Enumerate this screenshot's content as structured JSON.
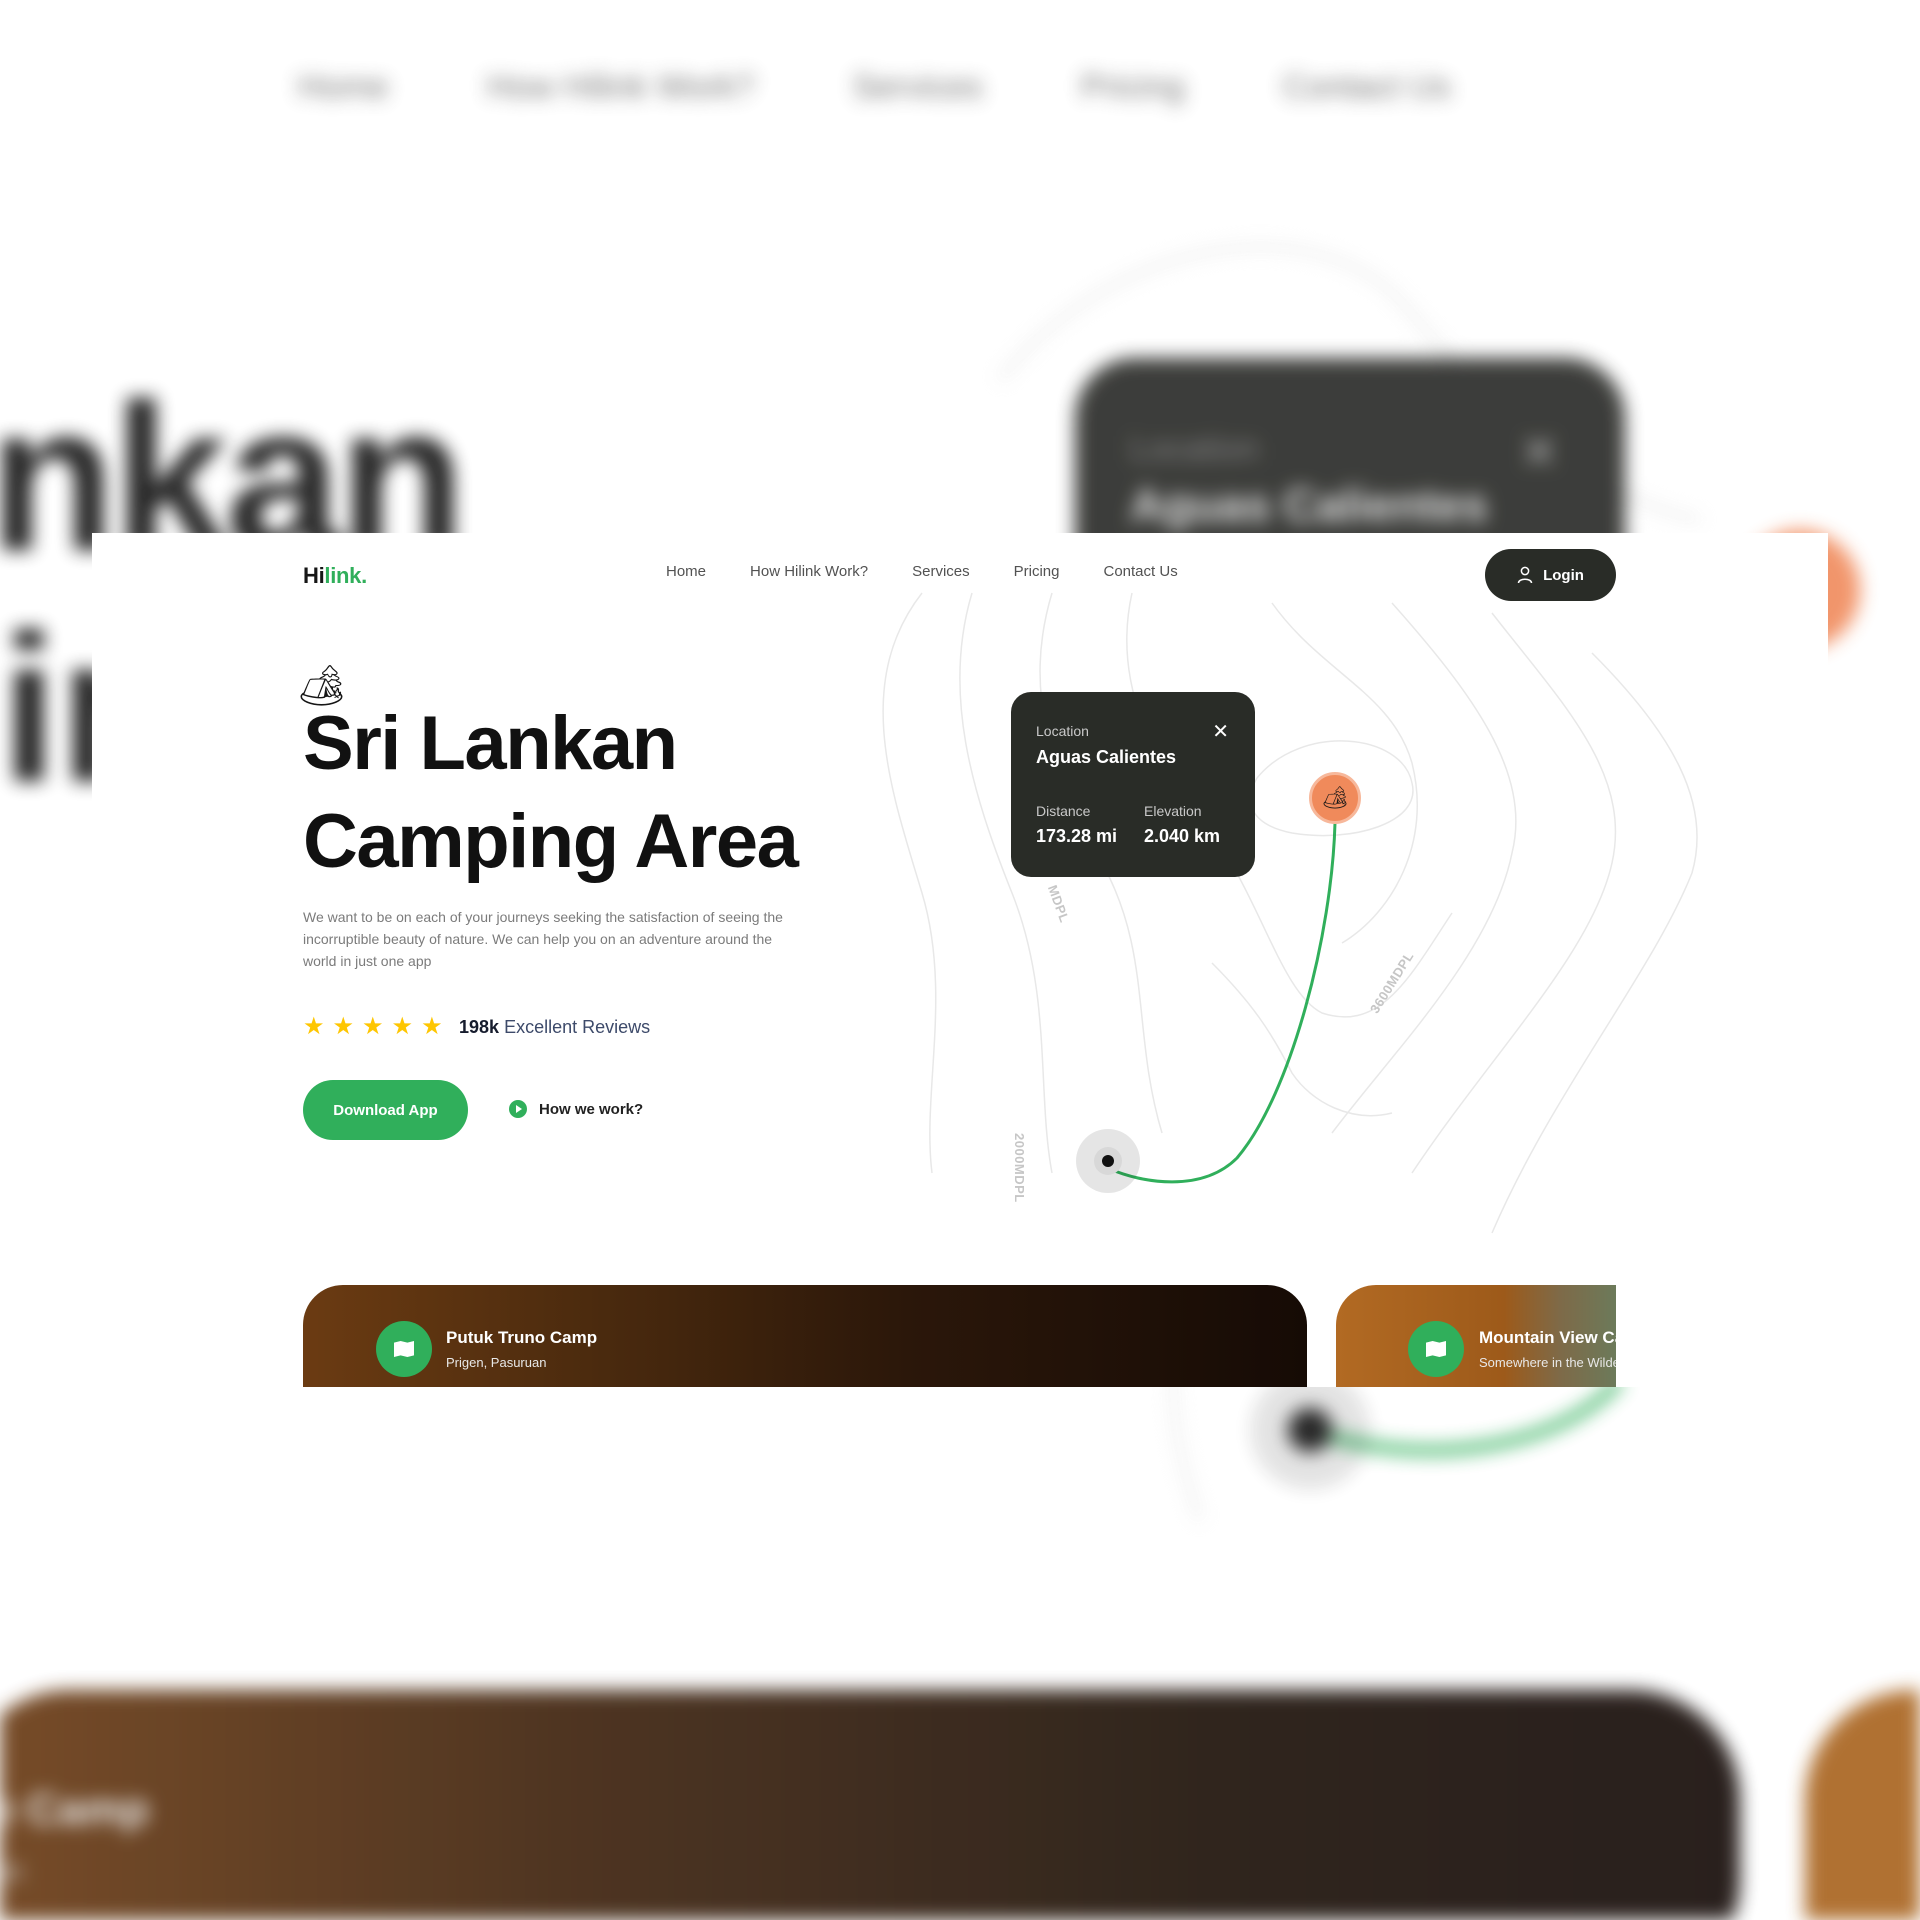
{
  "brand": {
    "part1": "Hi",
    "part2": "link."
  },
  "nav": [
    "Home",
    "How Hilink Work?",
    "Services",
    "Pricing",
    "Contact Us"
  ],
  "login_label": "Login",
  "hero": {
    "title_line1": "Sri Lankan",
    "title_line2": "Camping Area",
    "description": "We want to be on each of your journeys seeking the satisfaction of seeing the incorruptible beauty of nature. We can help you on an adventure around the world in just one app",
    "rating_stars": 5,
    "review_count": "198k",
    "review_text": "Excellent Reviews",
    "download_label": "Download App",
    "how_label": "How we work?"
  },
  "location_card": {
    "label": "Location",
    "value": "Aguas Calientes",
    "distance_label": "Distance",
    "distance_value": "173.28 mi",
    "elevation_label": "Elevation",
    "elevation_value": "2.040 km"
  },
  "map_labels": [
    "MDPL",
    "3600MDPL",
    "2000MDPL"
  ],
  "camps": [
    {
      "title": "Putuk Truno Camp",
      "subtitle": "Prigen, Pasuruan"
    },
    {
      "title": "Mountain View Camp",
      "subtitle": "Somewhere in the Wilderness"
    }
  ],
  "background": {
    "title_fragment1": "nkan",
    "title_fragment2": "in",
    "card_label": "Location",
    "card_value": "Aguas Calientes",
    "photo_title": "e Camp",
    "photo_sub": "an"
  },
  "colors": {
    "green": "#30af5b",
    "dark": "#292c27",
    "orange": "#f08a5b",
    "star": "#fec601"
  }
}
